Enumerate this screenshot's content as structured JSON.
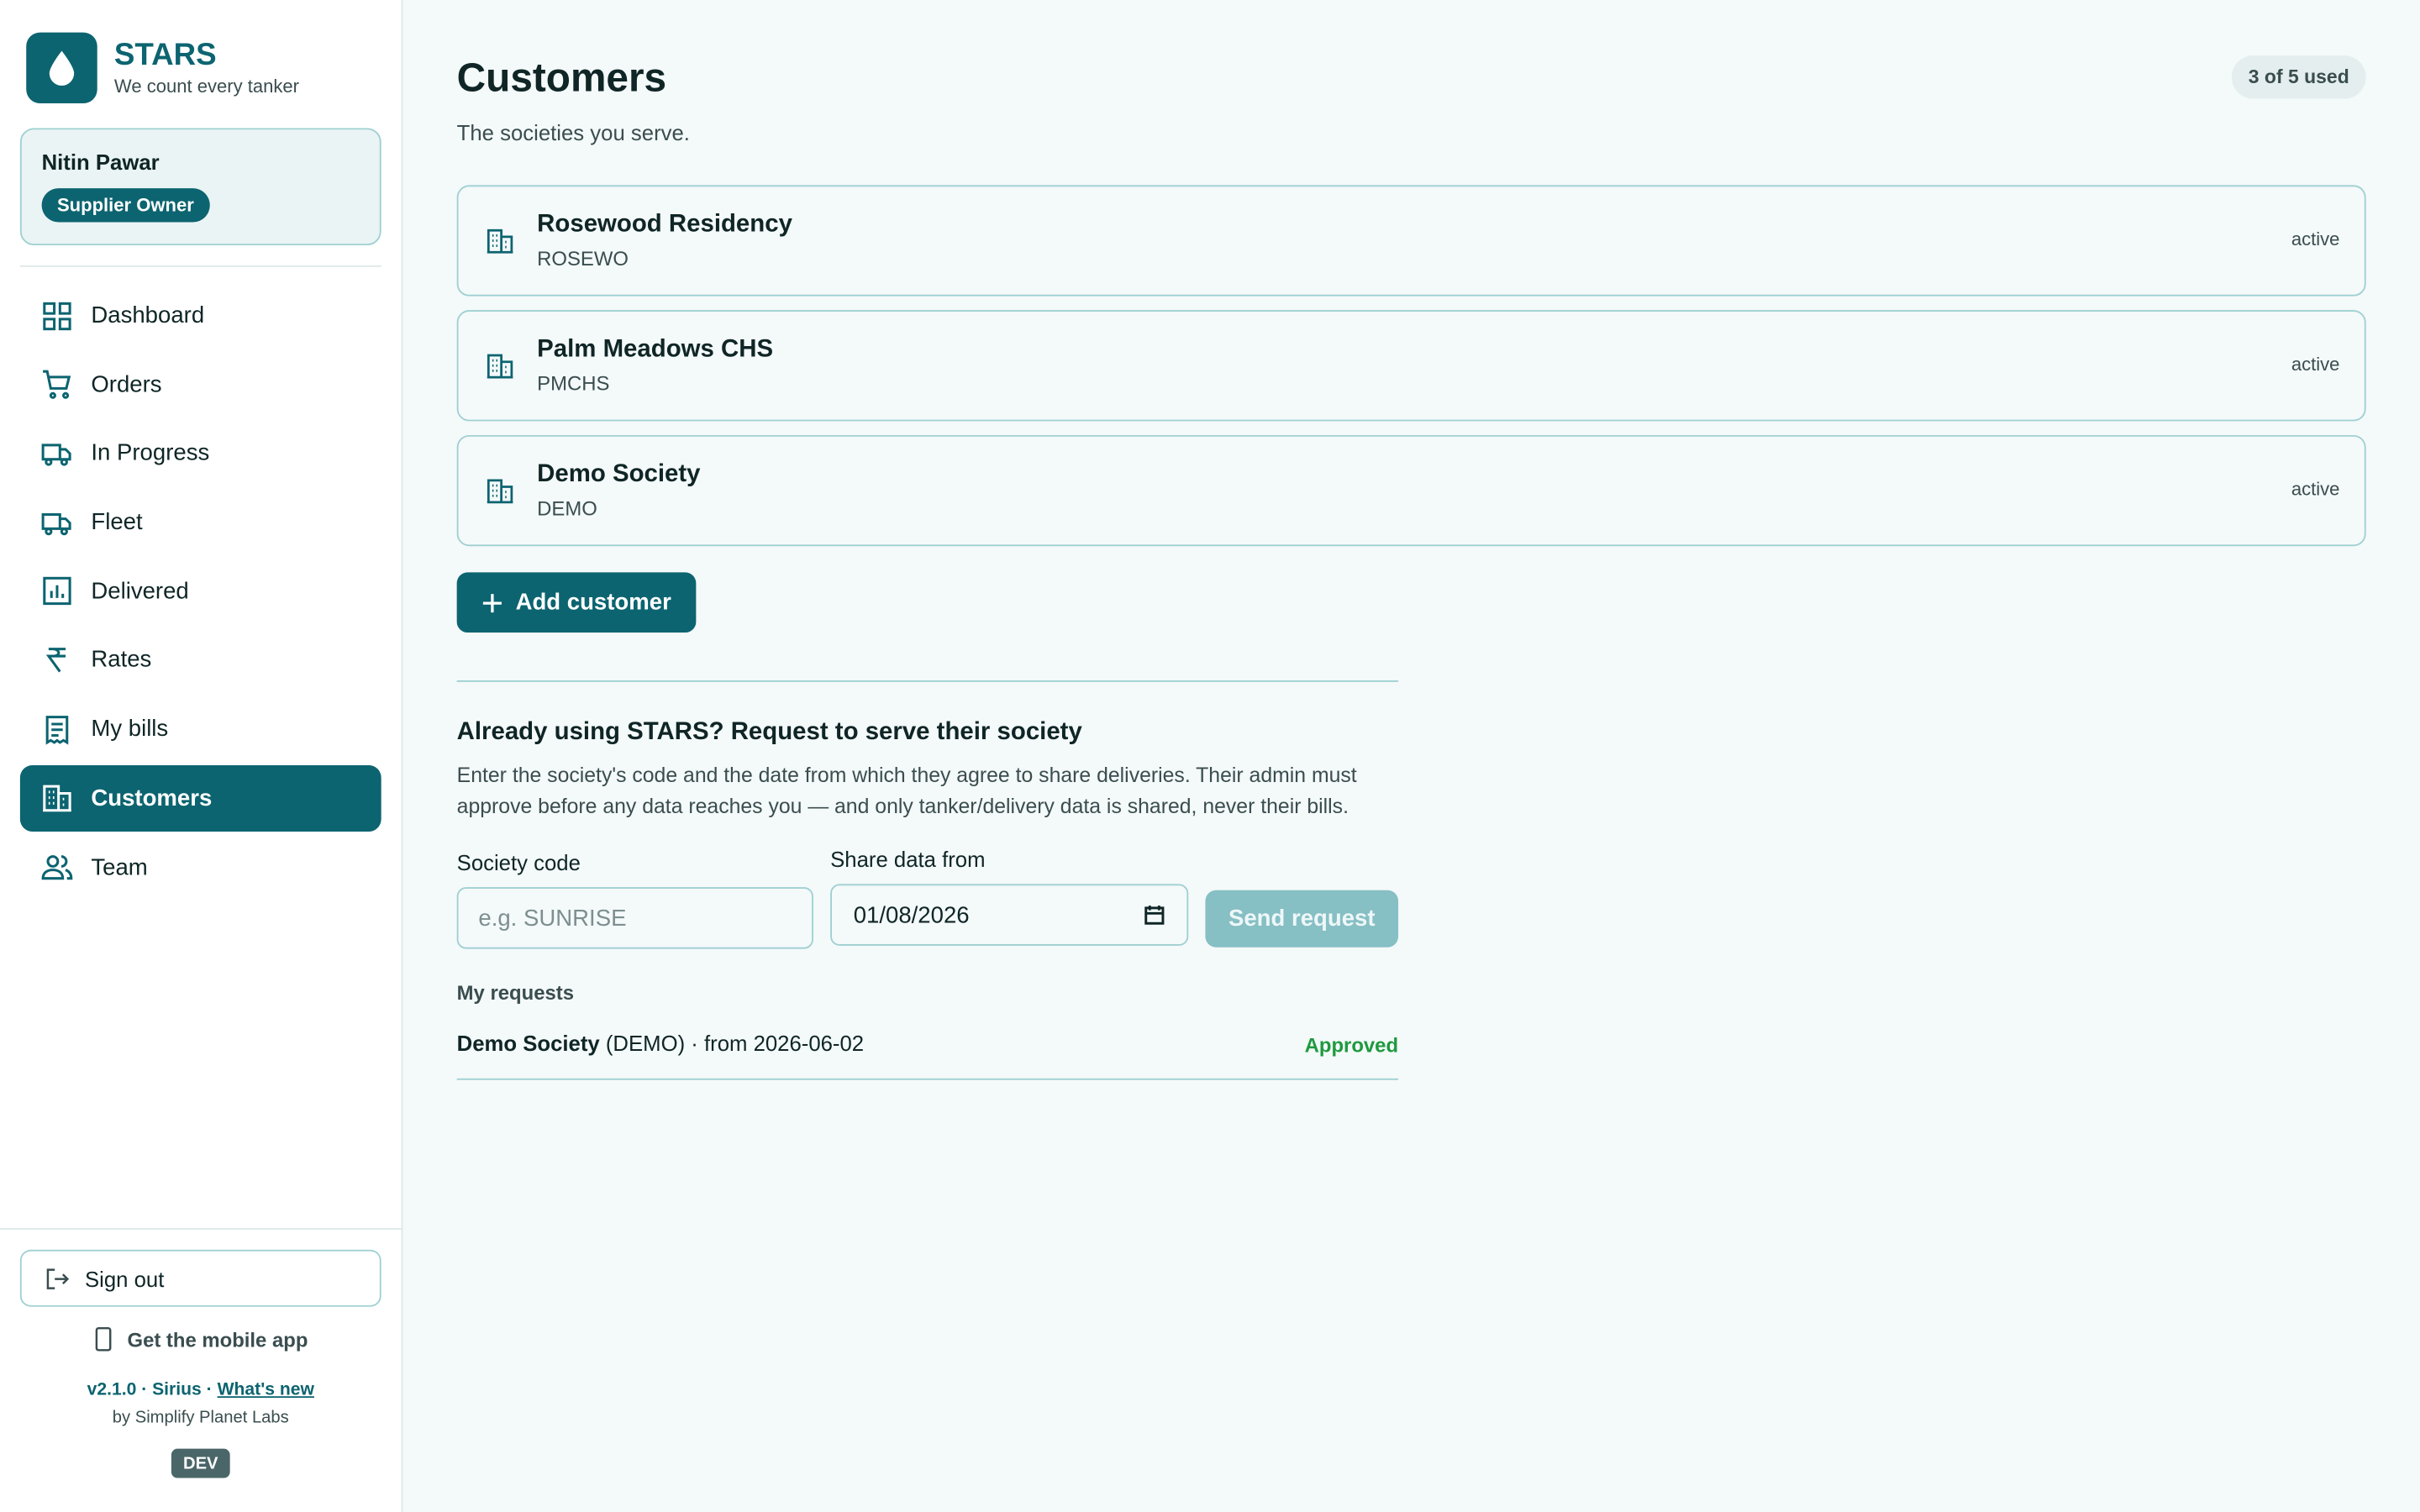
{
  "brand": {
    "name": "STARS",
    "tagline": "We count every tanker",
    "logo_icon": "water-drop-icon",
    "accent": "#0c6470"
  },
  "user": {
    "name": "Nitin Pawar",
    "role": "Supplier Owner"
  },
  "nav": {
    "items": [
      {
        "label": "Dashboard",
        "icon": "grid-icon",
        "active": false
      },
      {
        "label": "Orders",
        "icon": "cart-icon",
        "active": false
      },
      {
        "label": "In Progress",
        "icon": "truck-icon",
        "active": false
      },
      {
        "label": "Fleet",
        "icon": "truck-icon",
        "active": false
      },
      {
        "label": "Delivered",
        "icon": "chart-icon",
        "active": false
      },
      {
        "label": "Rates",
        "icon": "rupee-icon",
        "active": false
      },
      {
        "label": "My bills",
        "icon": "receipt-icon",
        "active": false
      },
      {
        "label": "Customers",
        "icon": "building-icon",
        "active": true
      },
      {
        "label": "Team",
        "icon": "people-icon",
        "active": false
      }
    ]
  },
  "footer": {
    "signout": "Sign out",
    "mobile_app": "Get the mobile app",
    "version": "v2.1.0 · Sirius · ",
    "whats_new": "What's new",
    "by": "by Simplify Planet Labs",
    "env": "DEV"
  },
  "page": {
    "title": "Customers",
    "usage": "3 of 5 used",
    "subtitle": "The societies you serve."
  },
  "customers": [
    {
      "name": "Rosewood Residency",
      "code": "ROSEWO",
      "status": "active"
    },
    {
      "name": "Palm Meadows CHS",
      "code": "PMCHS",
      "status": "active"
    },
    {
      "name": "Demo Society",
      "code": "DEMO",
      "status": "active"
    }
  ],
  "add_customer": "Add customer",
  "request": {
    "heading": "Already using STARS? Request to serve their society",
    "description": "Enter the society's code and the date from which they agree to share deliveries. Their admin must approve before any data reaches you — and only tanker/delivery data is shared, never their bills.",
    "code_label": "Society code",
    "code_placeholder": "e.g. SUNRISE",
    "date_label": "Share data from",
    "date_value": "01/08/2026",
    "send": "Send request",
    "my_requests": "My requests",
    "items": [
      {
        "society": "Demo Society",
        "detail": " (DEMO) · from 2026-06-02",
        "status": "Approved"
      }
    ]
  }
}
